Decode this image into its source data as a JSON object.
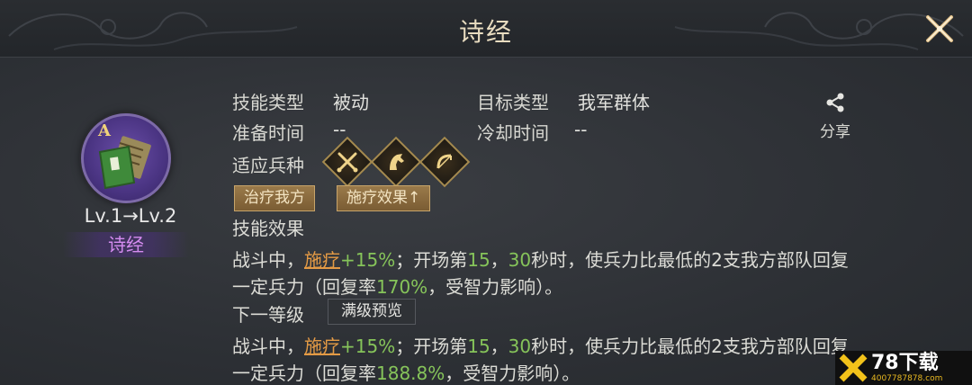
{
  "header": {
    "title": "诗经"
  },
  "skill": {
    "grade": "A",
    "level_text": "Lv.1→Lv.2",
    "name": "诗经"
  },
  "info": {
    "skill_type_label": "技能类型",
    "skill_type_value": "被动",
    "target_type_label": "目标类型",
    "target_type_value": "我军群体",
    "prep_time_label": "准备时间",
    "prep_time_value": "--",
    "cooldown_label": "冷却时间",
    "cooldown_value": "--",
    "troop_label": "适应兵种",
    "troop_icons": [
      "crossed-swords-icon",
      "horse-icon",
      "bow-icon"
    ]
  },
  "share": {
    "label": "分享"
  },
  "tags": [
    "治疗我方",
    "施疗效果↑"
  ],
  "effect": {
    "title": "技能效果",
    "line1_a": "战斗中，",
    "line1_link": "施疗",
    "line1_b": "+15%",
    "line1_c": "；开场第",
    "line1_d": "15",
    "line1_e": "，",
    "line1_f": "30",
    "line1_g": "秒时，使兵力比最低的2支我方部队回复",
    "line2_a": "一定兵力（回复率",
    "line2_b": "170%",
    "line2_c": "，受智力影响）。"
  },
  "next_level": {
    "title": "下一等级",
    "max_button": "满级预览",
    "line1_a": "战斗中，",
    "line1_link": "施疗",
    "line1_b": "+15%",
    "line1_c": "；开场第",
    "line1_d": "15",
    "line1_e": "，",
    "line1_f": "30",
    "line1_g": "秒时，使兵力比最低的2支我方部队回复",
    "line2_a": "一定兵力（回复率",
    "line2_b": "188.8%",
    "line2_c": "，受智力影响）。"
  },
  "watermark": {
    "title": "78下载",
    "url": "4007787878.com"
  },
  "colors": {
    "accent_orange": "#e39a45",
    "accent_green": "#86c45a",
    "skill_name_purple": "#d58cf0",
    "title_gold": "#e8dcc0"
  }
}
